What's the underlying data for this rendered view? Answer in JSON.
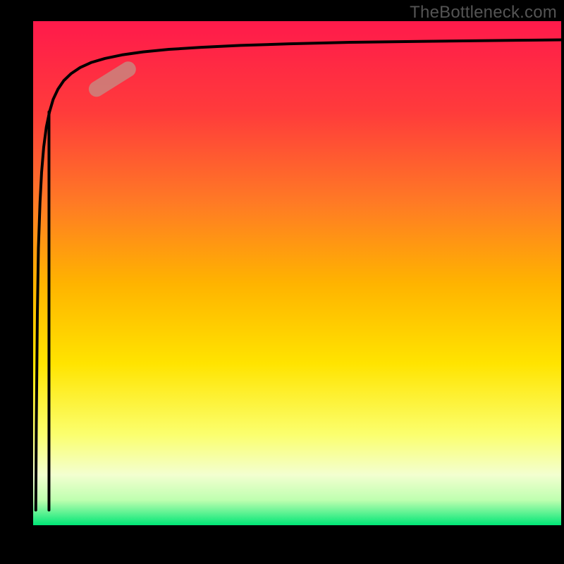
{
  "watermark": "TheBottleneck.com",
  "chart_data": {
    "type": "line",
    "title": "",
    "xlabel": "",
    "ylabel": "",
    "xlim": [
      0,
      100
    ],
    "ylim": [
      0,
      100
    ],
    "grid": false,
    "series": [
      {
        "name": "curve",
        "type": "line",
        "x": [
          0.5,
          0.6,
          0.8,
          1.0,
          1.3,
          1.6,
          2.0,
          2.5,
          3.1,
          3.8,
          4.7,
          5.8,
          7.2,
          8.9,
          11.0,
          13.6,
          16.8,
          20.8,
          25.7,
          31.8,
          39.3,
          48.6,
          60.1,
          74.3,
          91.8,
          100.0
        ],
        "y": [
          3.0,
          20.0,
          42.0,
          55.0,
          64.0,
          70.0,
          75.0,
          79.0,
          82.0,
          84.5,
          86.5,
          88.2,
          89.6,
          90.8,
          91.8,
          92.6,
          93.3,
          93.9,
          94.4,
          94.8,
          95.2,
          95.5,
          95.8,
          96.0,
          96.2,
          96.3
        ]
      },
      {
        "name": "vertical-drop",
        "type": "line",
        "x": [
          3.0,
          3.0
        ],
        "y": [
          82.0,
          3.0
        ]
      }
    ],
    "highlight": {
      "center_x": 15.0,
      "center_y": 88.5,
      "angle_deg": -32,
      "length": 10
    },
    "background_gradient": {
      "stops": [
        {
          "pos": 0.0,
          "color": "#ff1a4b"
        },
        {
          "pos": 0.18,
          "color": "#ff3b3b"
        },
        {
          "pos": 0.36,
          "color": "#ff7a25"
        },
        {
          "pos": 0.52,
          "color": "#ffb300"
        },
        {
          "pos": 0.68,
          "color": "#ffe400"
        },
        {
          "pos": 0.82,
          "color": "#fbff6e"
        },
        {
          "pos": 0.9,
          "color": "#f3ffd0"
        },
        {
          "pos": 0.95,
          "color": "#bfffb0"
        },
        {
          "pos": 1.0,
          "color": "#00e676"
        }
      ]
    }
  }
}
